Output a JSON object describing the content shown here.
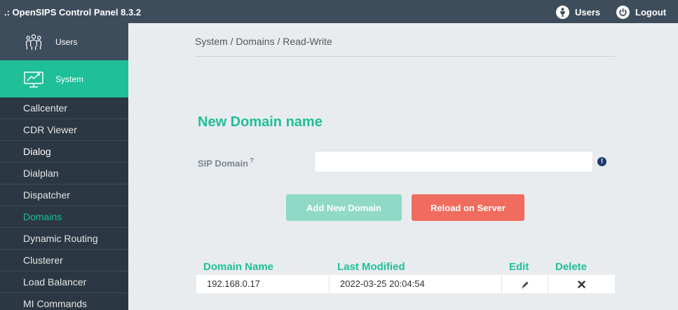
{
  "app": {
    "title": ".: OpenSIPS Control Panel 8.3.2",
    "top_users_label": "Users",
    "top_logout_label": "Logout"
  },
  "sidebar": {
    "groups": [
      {
        "label": "Users",
        "icon": "users-group-icon"
      },
      {
        "label": "System",
        "icon": "system-monitor-icon"
      }
    ],
    "items": [
      {
        "label": "Callcenter"
      },
      {
        "label": "CDR Viewer"
      },
      {
        "label": "Dialog"
      },
      {
        "label": "Dialplan"
      },
      {
        "label": "Dispatcher"
      },
      {
        "label": "Domains"
      },
      {
        "label": "Dynamic Routing"
      },
      {
        "label": "Clusterer"
      },
      {
        "label": "Load Balancer"
      },
      {
        "label": "MI Commands"
      }
    ],
    "active_item": "Domains"
  },
  "breadcrumb": "System / Domains / Read-Write",
  "form": {
    "title": "New Domain name",
    "sip_domain_label": "SIP Domain",
    "sip_domain_help": "?",
    "sip_domain_value": "",
    "warning_glyph": "!",
    "add_button": "Add New Domain",
    "reload_button": "Reload on Server"
  },
  "table": {
    "headers": [
      "Domain Name",
      "Last Modified",
      "Edit",
      "Delete"
    ],
    "rows": [
      {
        "domain": "192.168.0.17",
        "modified": "2022-03-25 20:04:54"
      }
    ]
  },
  "colors": {
    "accent": "#1fbf98",
    "topbar": "#3e4d5c",
    "sidebar": "#2b3742",
    "reload": "#ef6c5f",
    "add_disabled": "#8fd9c6"
  }
}
